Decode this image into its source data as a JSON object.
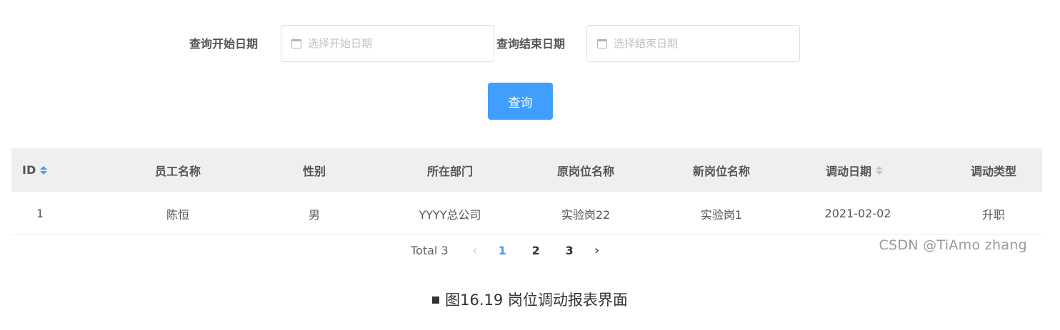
{
  "filters": {
    "start_label": "查询开始日期",
    "start_placeholder": "选择开始日期",
    "end_label": "查询结束日期",
    "end_placeholder": "选择结束日期"
  },
  "query_button": "查询",
  "table": {
    "columns": [
      "ID",
      "员工名称",
      "性别",
      "所在部门",
      "原岗位名称",
      "新岗位名称",
      "调动日期",
      "调动类型"
    ],
    "rows": [
      [
        "1",
        "陈恒",
        "男",
        "YYYY总公司",
        "实验岗22",
        "实验岗1",
        "2021-02-02",
        "升职"
      ]
    ]
  },
  "pagination": {
    "total_text": "Total 3",
    "pages": [
      "1",
      "2",
      "3"
    ],
    "current": "1"
  },
  "watermark": "CSDN @TiAmo zhang",
  "caption": "图16.19 岗位调动报表界面",
  "colors": {
    "primary": "#409eff",
    "header_bg": "#efefef",
    "border": "#dcdfe6"
  }
}
